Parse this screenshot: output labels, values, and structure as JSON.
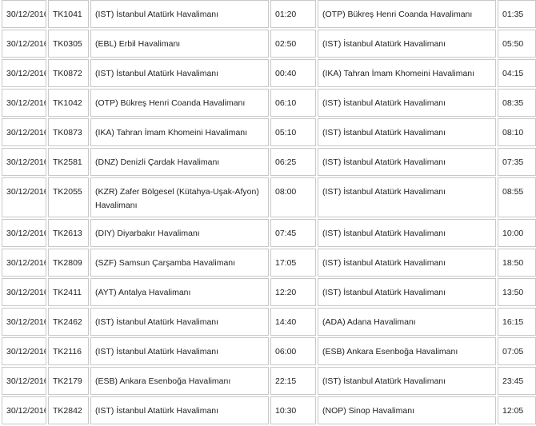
{
  "flights": [
    {
      "date": "30/12/2016",
      "flight": "TK1041",
      "origin": "(IST) İstanbul Atatürk Havalimanı",
      "departure": "01:20",
      "destination": "(OTP) Bükreş Henri Coanda Havalimanı",
      "arrival": "01:35"
    },
    {
      "date": "30/12/2016",
      "flight": "TK0305",
      "origin": "(EBL) Erbil Havalimanı",
      "departure": "02:50",
      "destination": "(IST) İstanbul Atatürk Havalimanı",
      "arrival": "05:50"
    },
    {
      "date": "30/12/2016",
      "flight": "TK0872",
      "origin": "(IST) İstanbul Atatürk Havalimanı",
      "departure": "00:40",
      "destination": "(IKA) Tahran İmam Khomeini Havalimanı",
      "arrival": "04:15"
    },
    {
      "date": "30/12/2016",
      "flight": "TK1042",
      "origin": "(OTP) Bükreş Henri Coanda Havalimanı",
      "departure": "06:10",
      "destination": "(IST) İstanbul Atatürk Havalimanı",
      "arrival": "08:35"
    },
    {
      "date": "30/12/2016",
      "flight": "TK0873",
      "origin": "(IKA) Tahran İmam Khomeini Havalimanı",
      "departure": "05:10",
      "destination": "(IST) İstanbul Atatürk Havalimanı",
      "arrival": "08:10"
    },
    {
      "date": "30/12/2016",
      "flight": "TK2581",
      "origin": "(DNZ) Denizli Çardak Havalimanı",
      "departure": "06:25",
      "destination": "(IST) İstanbul Atatürk Havalimanı",
      "arrival": "07:35"
    },
    {
      "date": "30/12/2016",
      "flight": "TK2055",
      "origin": "(KZR) Zafer Bölgesel (Kütahya-Uşak-Afyon) Havalimanı",
      "departure": "08:00",
      "destination": "(IST) İstanbul Atatürk Havalimanı",
      "arrival": "08:55"
    },
    {
      "date": "30/12/2016",
      "flight": "TK2613",
      "origin": "(DIY) Diyarbakır Havalimanı",
      "departure": "07:45",
      "destination": "(IST) İstanbul Atatürk Havalimanı",
      "arrival": "10:00"
    },
    {
      "date": "30/12/2016",
      "flight": "TK2809",
      "origin": "(SZF) Samsun Çarşamba Havalimanı",
      "departure": "17:05",
      "destination": "(IST) İstanbul Atatürk Havalimanı",
      "arrival": "18:50"
    },
    {
      "date": "30/12/2016",
      "flight": "TK2411",
      "origin": "(AYT) Antalya Havalimanı",
      "departure": "12:20",
      "destination": "(IST) İstanbul Atatürk Havalimanı",
      "arrival": "13:50"
    },
    {
      "date": "30/12/2016",
      "flight": "TK2462",
      "origin": "(IST) İstanbul Atatürk Havalimanı",
      "departure": "14:40",
      "destination": "(ADA) Adana Havalimanı",
      "arrival": "16:15"
    },
    {
      "date": "30/12/2016",
      "flight": "TK2116",
      "origin": "(IST) İstanbul Atatürk Havalimanı",
      "departure": "06:00",
      "destination": "(ESB) Ankara Esenboğa Havalimanı",
      "arrival": "07:05"
    },
    {
      "date": "30/12/2016",
      "flight": "TK2179",
      "origin": "(ESB) Ankara Esenboğa Havalimanı",
      "departure": "22:15",
      "destination": "(IST) İstanbul Atatürk Havalimanı",
      "arrival": "23:45"
    },
    {
      "date": "30/12/2016",
      "flight": "TK2842",
      "origin": "(IST) İstanbul Atatürk Havalimanı",
      "departure": "10:30",
      "destination": "(NOP) Sinop Havalimanı",
      "arrival": "12:05"
    }
  ]
}
